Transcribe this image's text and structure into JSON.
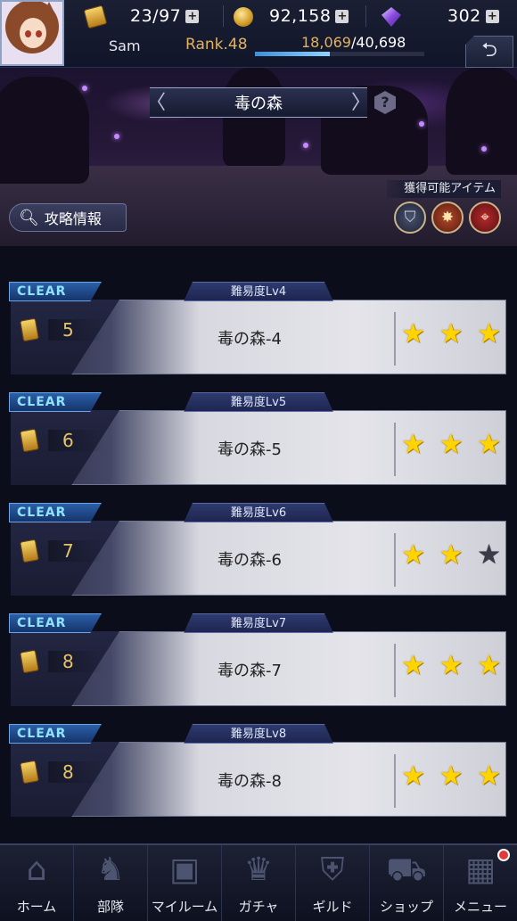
{
  "header": {
    "player_name": "Sam",
    "rank": "Rank.48",
    "exp_current": "18,069",
    "exp_total": "/40,698",
    "exp_ratio": 0.444,
    "resources": {
      "stamina": "23/97",
      "coins": "92,158",
      "gems": "302"
    },
    "plus_label": "+",
    "back_icon": "return-arrow-icon"
  },
  "stage_area": {
    "title": "毒の森",
    "prev_arrow": "〈",
    "next_arrow": "〉",
    "help_label": "?",
    "guide_button": "攻略情報",
    "obtainable_items_label": "獲得可能アイテム",
    "item_icons": [
      "shield-icon",
      "burst-icon",
      "target-icon"
    ]
  },
  "stages": [
    {
      "badge": "CLEAR",
      "difficulty": "難易度Lv4",
      "cost": "5",
      "name": "毒の森-4",
      "stars": 3
    },
    {
      "badge": "CLEAR",
      "difficulty": "難易度Lv5",
      "cost": "6",
      "name": "毒の森-5",
      "stars": 3
    },
    {
      "badge": "CLEAR",
      "difficulty": "難易度Lv6",
      "cost": "7",
      "name": "毒の森-6",
      "stars": 2
    },
    {
      "badge": "CLEAR",
      "difficulty": "難易度Lv7",
      "cost": "8",
      "name": "毒の森-7",
      "stars": 3
    },
    {
      "badge": "CLEAR",
      "difficulty": "難易度Lv8",
      "cost": "8",
      "name": "毒の森-8",
      "stars": 3
    }
  ],
  "nav": [
    {
      "label": "ホーム",
      "icon": "home-icon"
    },
    {
      "label": "部隊",
      "icon": "squad-icon"
    },
    {
      "label": "マイルーム",
      "icon": "myroom-icon"
    },
    {
      "label": "ガチャ",
      "icon": "gacha-icon"
    },
    {
      "label": "ギルド",
      "icon": "guild-icon"
    },
    {
      "label": "ショップ",
      "icon": "shop-icon"
    },
    {
      "label": "メニュー",
      "icon": "menu-icon"
    }
  ],
  "colors": {
    "accent_gold": "#e3b25c",
    "clear_badge": "#8fe3ff",
    "star_on": "#ffd400",
    "star_off": "#3a3a48"
  }
}
